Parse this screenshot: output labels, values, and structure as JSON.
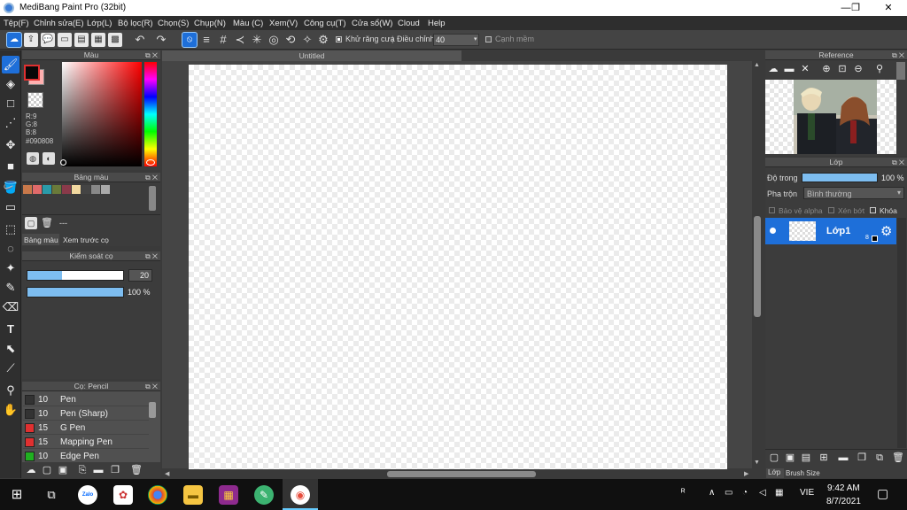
{
  "window": {
    "title": "MediBang Paint Pro (32bit)",
    "minimize": "—",
    "maximize": "❐",
    "close": "✕"
  },
  "menu": [
    "Tệp(F)",
    "Chỉnh sửa(E)",
    "Lớp(L)",
    "Bộ lọc(R)",
    "Chọn(S)",
    "Chụp(N)",
    "Màu (C)",
    "Xem(V)",
    "Công cụ(T)",
    "Cửa sổ(W)",
    "Cloud",
    "Help"
  ],
  "toolbar": {
    "antialias_label": "Khử răng cưa",
    "adjust_label": "Điều chỉnh",
    "adjust_value": "40",
    "edge_label": "Cạnh mềm"
  },
  "color_panel": {
    "title": "Màu",
    "r": "R:9",
    "g": "G:8",
    "b": "B:8",
    "hex": "#090808",
    "primary_color": "#090808",
    "secondary_color": "#ffb0b0"
  },
  "palette_panel": {
    "title": "Bảng màu",
    "swatches": [
      "#c8784a",
      "#e06a6a",
      "#2a9aa8",
      "#6a7a3a",
      "#8a3a4a",
      "#f2d9a0",
      "#444444",
      "#888888",
      "#aaaaaa"
    ],
    "tab_palette": "Bảng màu",
    "tab_preview": "Xem trước cọ",
    "name": "---"
  },
  "brush_control": {
    "title": "Kiểm soát cọ",
    "size_value": "20",
    "size_fill": 0.36,
    "opacity_value": "100 %",
    "opacity_fill": 1.0
  },
  "brush_panel": {
    "title": "Cọ: Pencil",
    "items": [
      {
        "size": "10",
        "name": "Pen",
        "color": "#333333"
      },
      {
        "size": "10",
        "name": "Pen (Sharp)",
        "color": "#333333"
      },
      {
        "size": "15",
        "name": "G Pen",
        "color": "#e03030"
      },
      {
        "size": "15",
        "name": "Mapping Pen",
        "color": "#e03030"
      },
      {
        "size": "10",
        "name": "Edge Pen",
        "color": "#20b020"
      }
    ]
  },
  "canvas": {
    "tab_title": "Untitled"
  },
  "reference_panel": {
    "title": "Reference"
  },
  "layer_panel": {
    "title": "Lớp",
    "opacity_label": "Độ trong",
    "opacity_value": "100 %",
    "opacity_fill": 1.0,
    "blend_label": "Pha trộn",
    "blend_value": "Bình thường",
    "protect_alpha": "Bảo vệ alpha",
    "clipping": "Xén bớt",
    "lock": "Khóa",
    "layer_name": "Lớp1",
    "layer_badge": "8",
    "tab_layer": "Lớp",
    "tab_brush_size": "Brush Size"
  },
  "taskbar": {
    "time": "9:42 AM",
    "date": "8/7/2021",
    "lang": "VIE",
    "zalo": "Zalo"
  }
}
